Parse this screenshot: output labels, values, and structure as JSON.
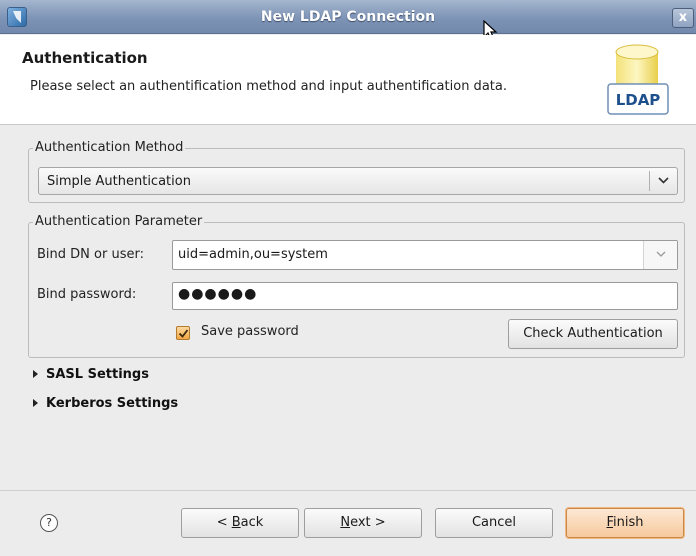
{
  "window": {
    "title": "New LDAP Connection",
    "close_label": "x"
  },
  "header": {
    "title": "Authentication",
    "description": "Please select an authentification method and input authentification data.",
    "badge": "LDAP"
  },
  "method": {
    "legend": "Authentication Method",
    "selected": "Simple Authentication"
  },
  "params": {
    "legend": "Authentication Parameter",
    "bind_dn_label": "Bind DN or user:",
    "bind_dn_value": "uid=admin,ou=system",
    "password_label": "Bind password:",
    "password_value": "●●●●●●",
    "save_password_label": "Save password",
    "save_password_checked": true,
    "check_button": "Check Authentication"
  },
  "sections": {
    "sasl": "SASL Settings",
    "kerberos": "Kerberos Settings"
  },
  "footer": {
    "back_pre": "< ",
    "back_mnemonic": "B",
    "back_rest": "ack",
    "next_mnemonic": "N",
    "next_rest": "ext >",
    "cancel": "Cancel",
    "finish_mnemonic": "F",
    "finish_rest": "inish",
    "help": "?"
  },
  "colors": {
    "titlebar": "#7e94b6",
    "default_button": "#f6c99c",
    "checkbox": "#f2a742"
  }
}
